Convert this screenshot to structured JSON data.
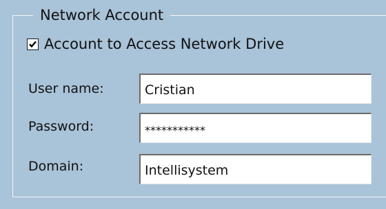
{
  "group": {
    "title": "Network Account"
  },
  "checkbox": {
    "label": "Account to Access Network Drive",
    "checked": true
  },
  "fields": {
    "username": {
      "label": "User name:",
      "value": "Cristian"
    },
    "password": {
      "label": "Password:",
      "value": "***********"
    },
    "domain": {
      "label": "Domain:",
      "value": "Intellisystem"
    }
  }
}
